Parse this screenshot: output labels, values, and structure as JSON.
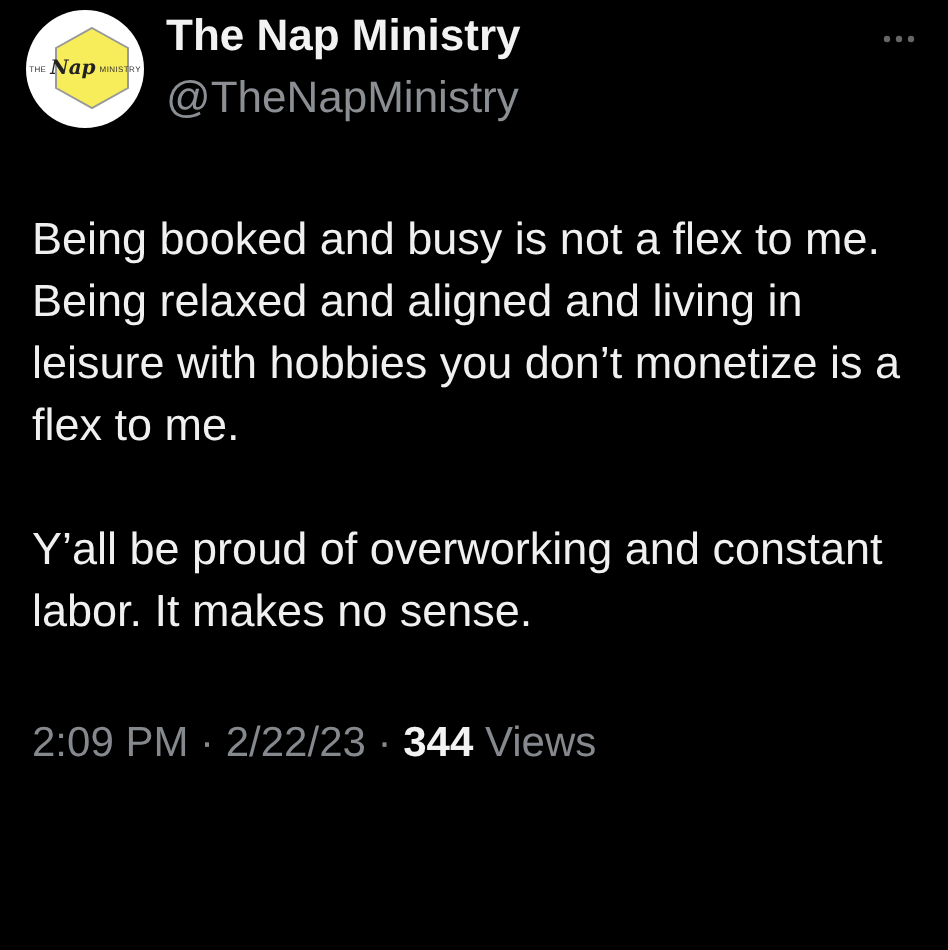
{
  "author": {
    "name": "The Nap Ministry",
    "handle": "@TheNapMinistry",
    "avatar_text": [
      "THE",
      "Nap",
      "MINISTRY"
    ]
  },
  "body": [
    [
      "Being booked and busy is not a flex to me.",
      "Being relaxed and aligned and living in leisure with hobbies you don’t monetize is a flex to me."
    ],
    [
      "Y’all be proud of overworking and constant labor. It makes no sense."
    ]
  ],
  "footer": "2:09 PM · 2/22/23 · **344** Views"
}
